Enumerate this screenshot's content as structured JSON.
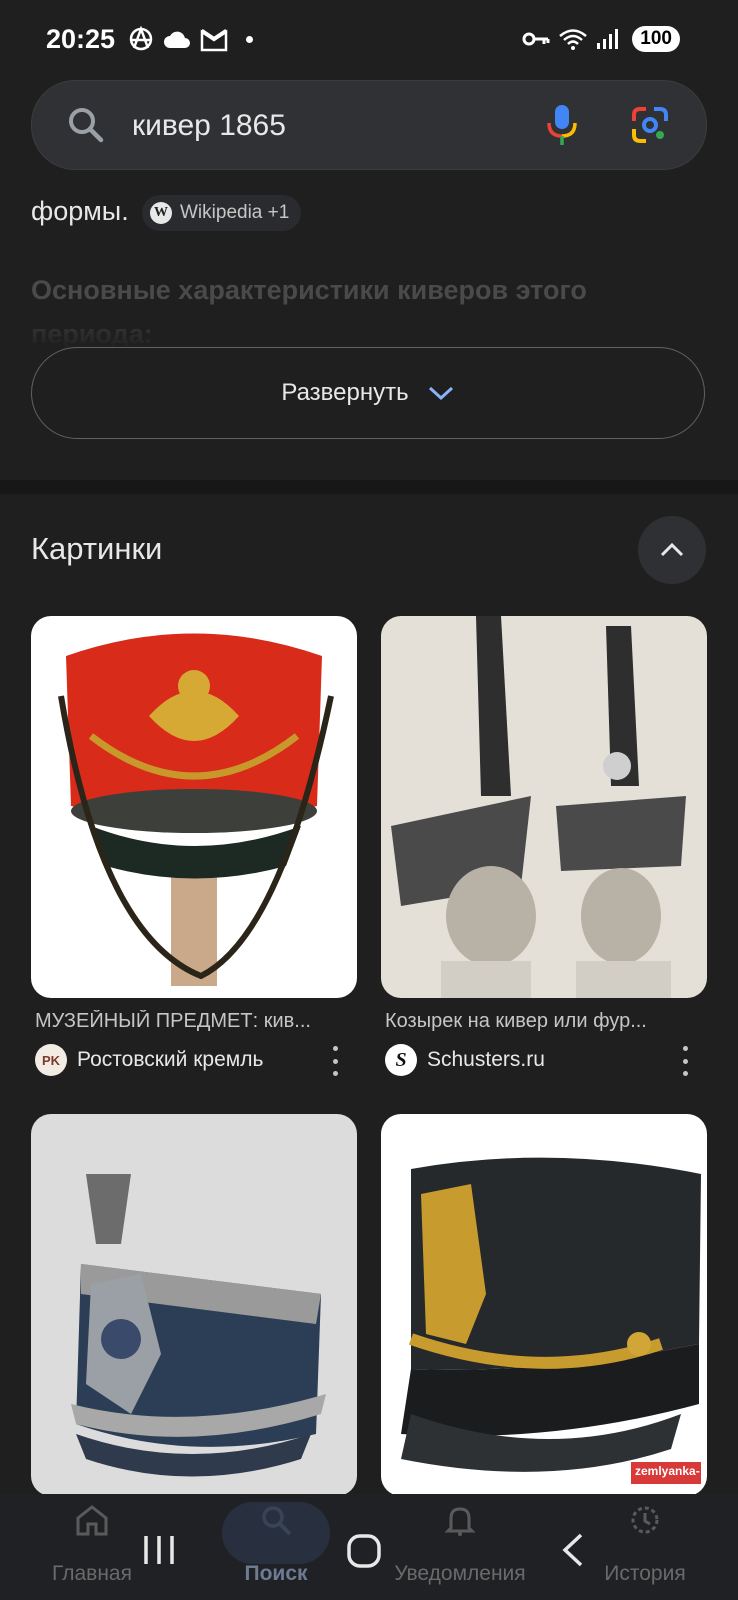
{
  "status_bar": {
    "time": "20:25",
    "battery": "100",
    "icons_left": [
      "anarchy-icon",
      "cloud-icon",
      "mail-m-icon",
      "dot"
    ],
    "icons_right": [
      "vpn-key-icon",
      "wifi-icon",
      "signal-icon"
    ]
  },
  "search": {
    "query": "кивер 1865"
  },
  "ai_overview": {
    "text_tail": "формы.",
    "source_chip": "Wikipedia +1",
    "faded_text": "Основные характеристики киверов этого периода:",
    "expand_label": "Развернуть"
  },
  "images_section": {
    "title": "Картинки",
    "cards": [
      {
        "caption": "МУЗЕЙНЫЙ ПРЕДМЕТ: кив...",
        "source": "Ростовский кремль",
        "source_badge": "PK"
      },
      {
        "caption": "Козырек на кивер или фур...",
        "source": "Schusters.ru",
        "source_badge": "S"
      },
      {
        "caption": "",
        "source": "",
        "source_badge": ""
      },
      {
        "caption": "",
        "source": "",
        "source_badge": "",
        "watermark": "zemlyanka-"
      }
    ]
  },
  "bottom_nav": {
    "items": [
      {
        "label": "Главная"
      },
      {
        "label": "Поиск"
      },
      {
        "label": "Уведомления"
      },
      {
        "label": "История"
      }
    ]
  },
  "colors": {
    "background": "#1f1f1f",
    "search_bar": "#303134",
    "accent_blue": "#8ab4f8"
  }
}
